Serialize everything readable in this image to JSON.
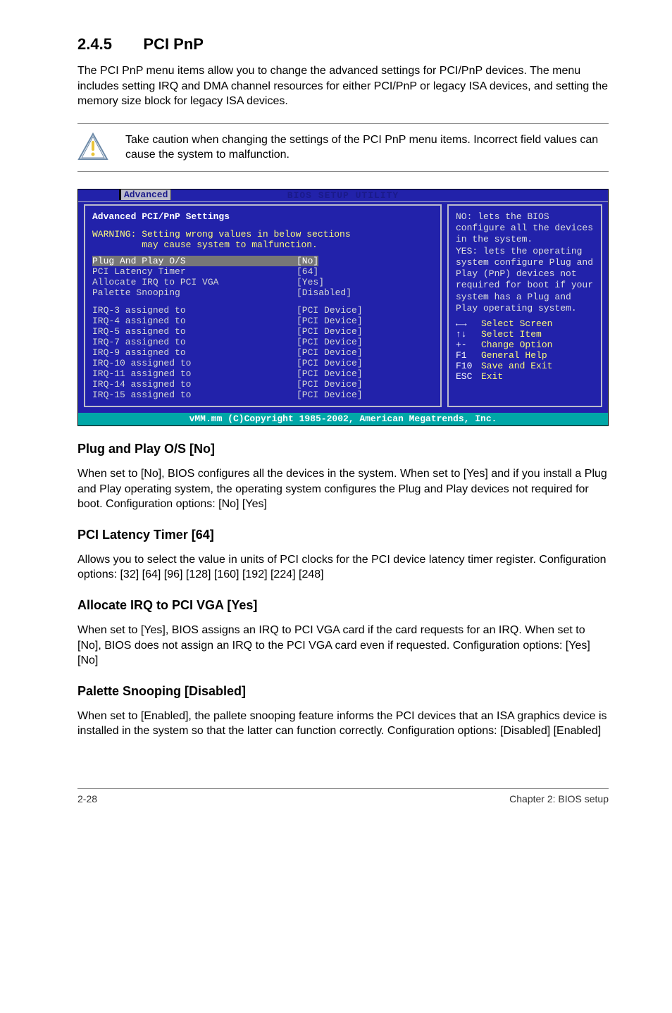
{
  "section": {
    "number": "2.4.5",
    "title": "PCI PnP"
  },
  "intro_para": "The PCI PnP menu items allow you to change the advanced settings for PCI/PnP devices. The menu includes setting IRQ and DMA channel resources for either PCI/PnP or legacy ISA devices, and setting the memory size block for legacy ISA devices.",
  "callout": "Take caution when changing the settings of the PCI PnP menu items. Incorrect field values can cause the system to malfunction.",
  "bios": {
    "title": "BIOS SETUP UTILITY",
    "tab": "Advanced",
    "left_heading": "Advanced PCI/PnP Settings",
    "warning_l1": "WARNING: Setting wrong values in below sections",
    "warning_l2": "         may cause system to malfunction.",
    "highlight": {
      "label": "Plug And Play O/S",
      "value": "[No]"
    },
    "rows_top": [
      {
        "label": "PCI Latency Timer",
        "value": "[64]"
      },
      {
        "label": "Allocate IRQ to PCI VGA",
        "value": "[Yes]"
      },
      {
        "label": "Palette Snooping",
        "value": "[Disabled]"
      }
    ],
    "rows_irq": [
      {
        "label": "IRQ-3 assigned to",
        "value": "[PCI Device]"
      },
      {
        "label": "IRQ-4 assigned to",
        "value": "[PCI Device]"
      },
      {
        "label": "IRQ-5 assigned to",
        "value": "[PCI Device]"
      },
      {
        "label": "IRQ-7 assigned to",
        "value": "[PCI Device]"
      },
      {
        "label": "IRQ-9 assigned to",
        "value": "[PCI Device]"
      },
      {
        "label": "IRQ-10 assigned to",
        "value": "[PCI Device]"
      },
      {
        "label": "IRQ-11 assigned to",
        "value": "[PCI Device]"
      },
      {
        "label": "IRQ-14 assigned to",
        "value": "[PCI Device]"
      },
      {
        "label": "IRQ-15 assigned to",
        "value": "[PCI Device]"
      }
    ],
    "help_text": "NO: lets the BIOS configure all the devices in the system.\nYES: lets the operating system configure Plug and Play (PnP) devices not required for boot if your system has a Plug and Play operating system.",
    "keys": [
      {
        "k": "←→",
        "d": "Select Screen"
      },
      {
        "k": "↑↓",
        "d": "Select Item"
      },
      {
        "k": "+-",
        "d": "Change Option"
      },
      {
        "k": "F1",
        "d": "General Help"
      },
      {
        "k": "F10",
        "d": "Save and Exit"
      },
      {
        "k": "ESC",
        "d": "Exit"
      }
    ],
    "footer": "vMM.mm (C)Copyright 1985-2002, American Megatrends, Inc."
  },
  "sections": [
    {
      "heading": "Plug and Play O/S [No]",
      "body": "When set to [No], BIOS configures all the devices in the system. When set to [Yes] and if you install a Plug and Play operating system, the operating system configures the Plug and Play devices not required for boot. Configuration options: [No] [Yes]"
    },
    {
      "heading": "PCI Latency Timer [64]",
      "body": "Allows you to select the value in units of PCI clocks for the PCI device latency timer register. Configuration options: [32] [64] [96] [128] [160] [192] [224] [248]"
    },
    {
      "heading": "Allocate IRQ to PCI VGA [Yes]",
      "body": "When set to [Yes], BIOS assigns an IRQ to PCI VGA card if the card requests for an IRQ. When set to [No], BIOS does not assign an IRQ to the PCI VGA card even if requested. Configuration options: [Yes] [No]"
    },
    {
      "heading": "Palette Snooping [Disabled]",
      "body": "When set to [Enabled], the pallete snooping feature informs the PCI devices that an ISA graphics device is installed in the system so that the latter can function correctly. Configuration options: [Disabled] [Enabled]"
    }
  ],
  "footer": {
    "left": "2-28",
    "right": "Chapter 2: BIOS setup"
  }
}
